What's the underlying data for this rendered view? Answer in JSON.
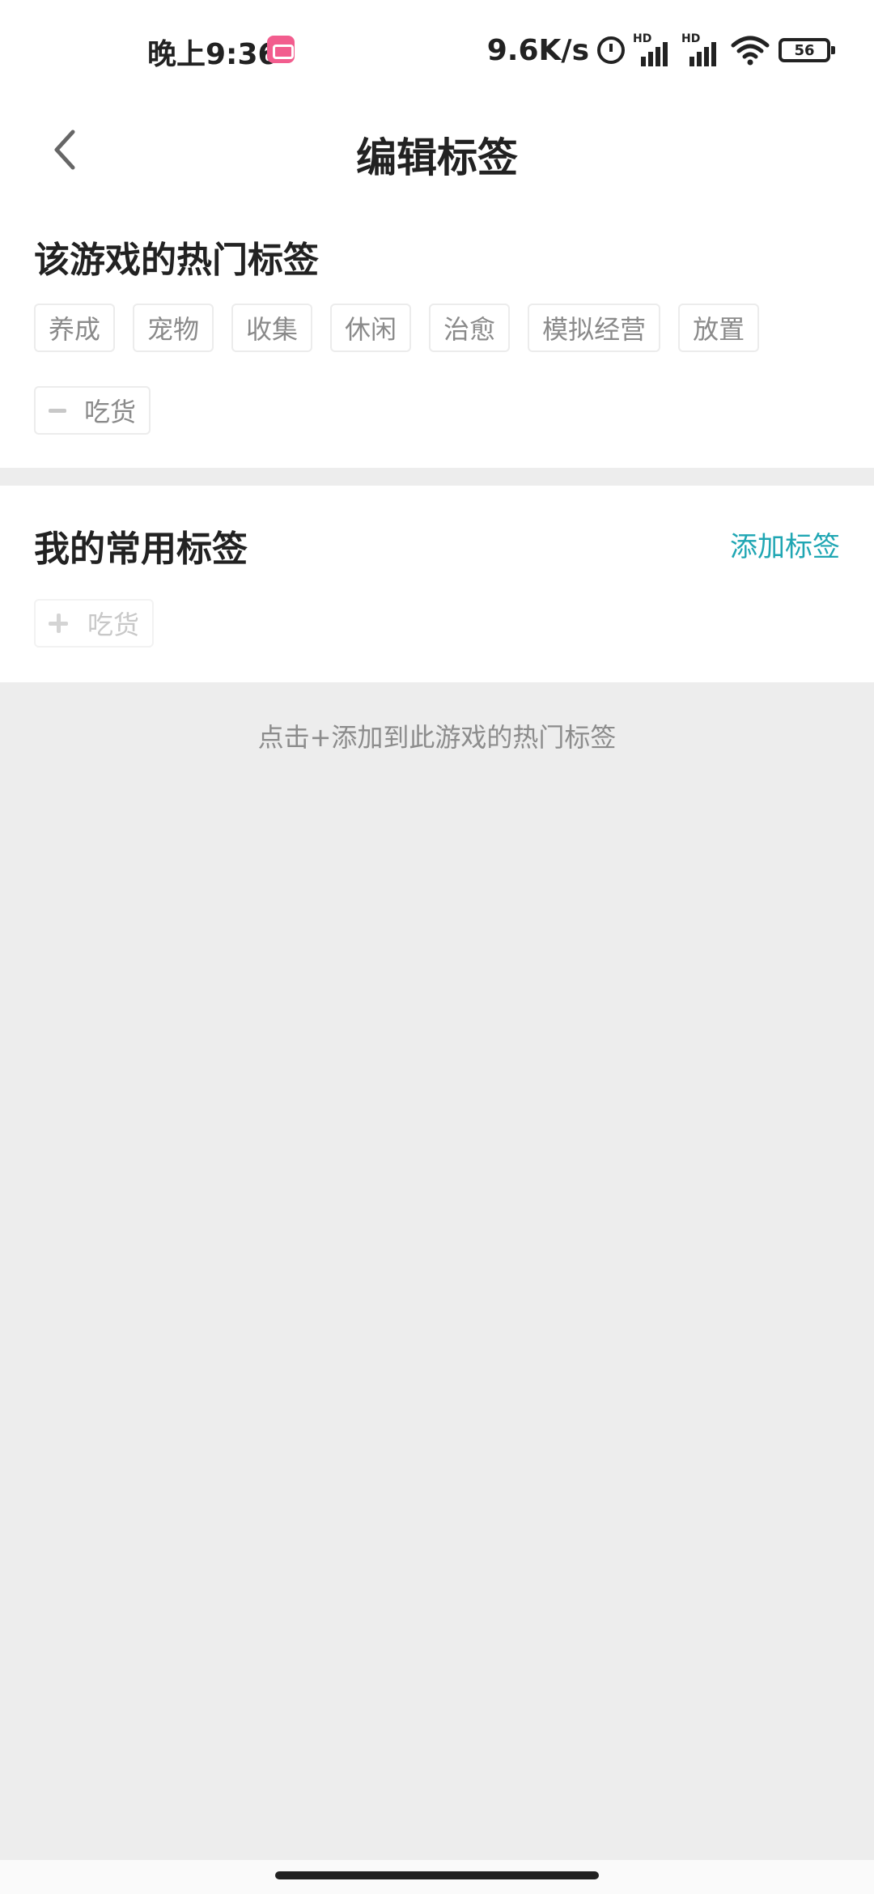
{
  "status_bar": {
    "time": "晚上9:36",
    "net_speed": "9.6K/s",
    "signal_label_1": "HD",
    "signal_label_2": "HD",
    "battery_level": "56"
  },
  "nav": {
    "title": "编辑标签"
  },
  "hot_tags_section": {
    "title": "该游戏的热门标签",
    "tags": [
      "养成",
      "宠物",
      "收集",
      "休闲",
      "治愈",
      "模拟经营",
      "放置"
    ],
    "removable_tag": "吃货"
  },
  "my_tags_section": {
    "title": "我的常用标签",
    "add_label": "添加标签",
    "tags": [
      "吃货"
    ]
  },
  "hint": "点击+添加到此游戏的热门标签",
  "colors": {
    "accent": "#1fa6b3",
    "background": "#ededed",
    "app_badge": "#f25d8e"
  }
}
